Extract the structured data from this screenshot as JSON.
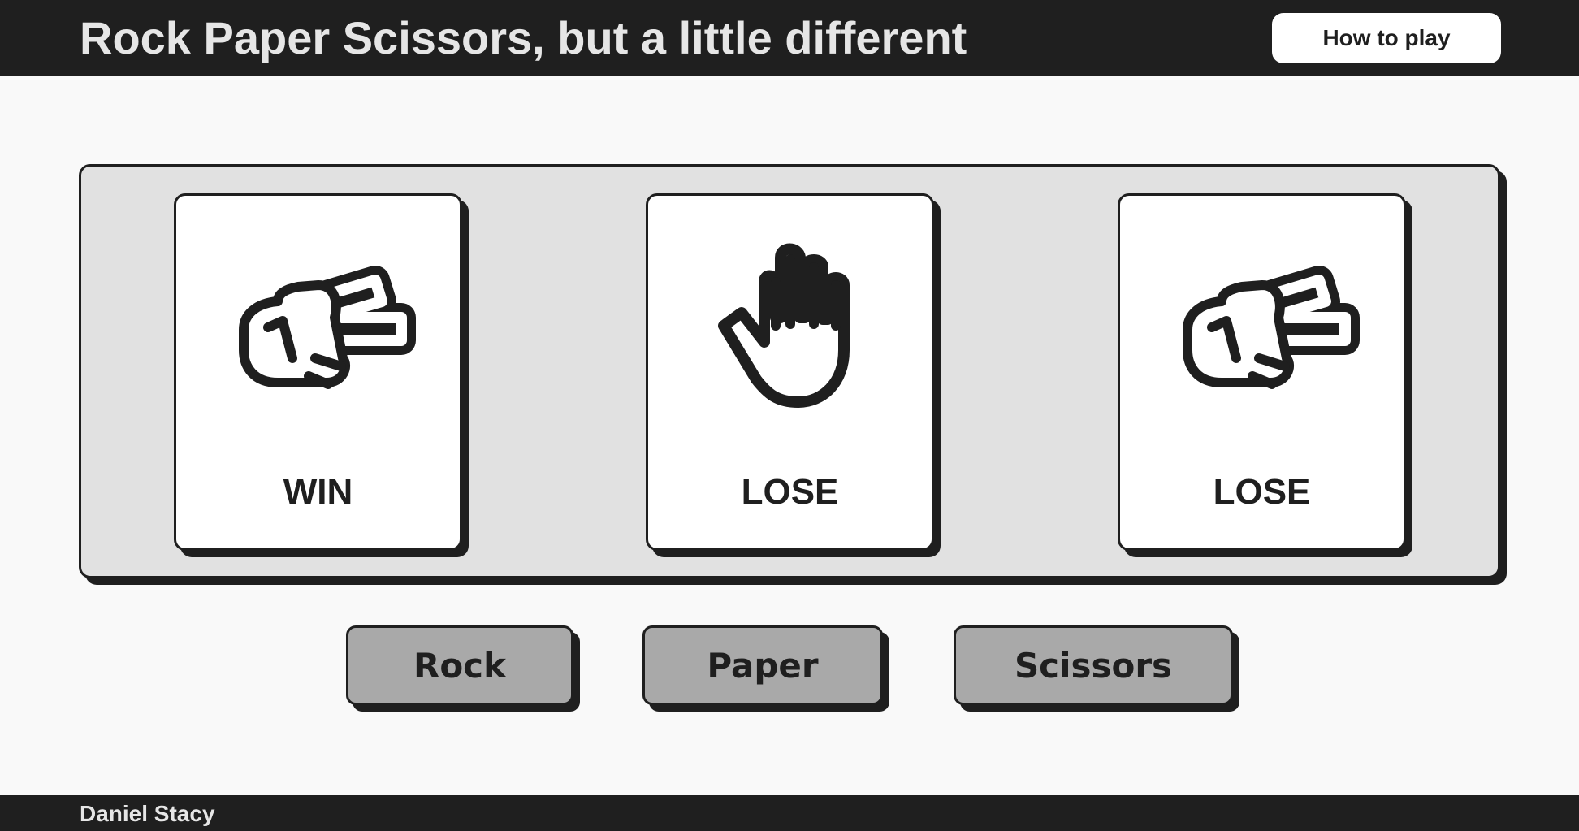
{
  "header": {
    "title": "Rock Paper Scissors, but a little different",
    "how_to_play_label": "How to play"
  },
  "cards": [
    {
      "icon": "scissors-hand-icon",
      "result": "WIN"
    },
    {
      "icon": "paper-hand-icon",
      "result": "LOSE"
    },
    {
      "icon": "scissors-hand-icon",
      "result": "LOSE"
    }
  ],
  "choices": {
    "rock_label": "Rock",
    "paper_label": "Paper",
    "scissors_label": "Scissors"
  },
  "footer": {
    "author": "Daniel Stacy"
  },
  "colors": {
    "dark": "#1f1f1f",
    "board": "#e1e1e1",
    "button": "#a9a9a9",
    "background": "#f9f9f9"
  }
}
